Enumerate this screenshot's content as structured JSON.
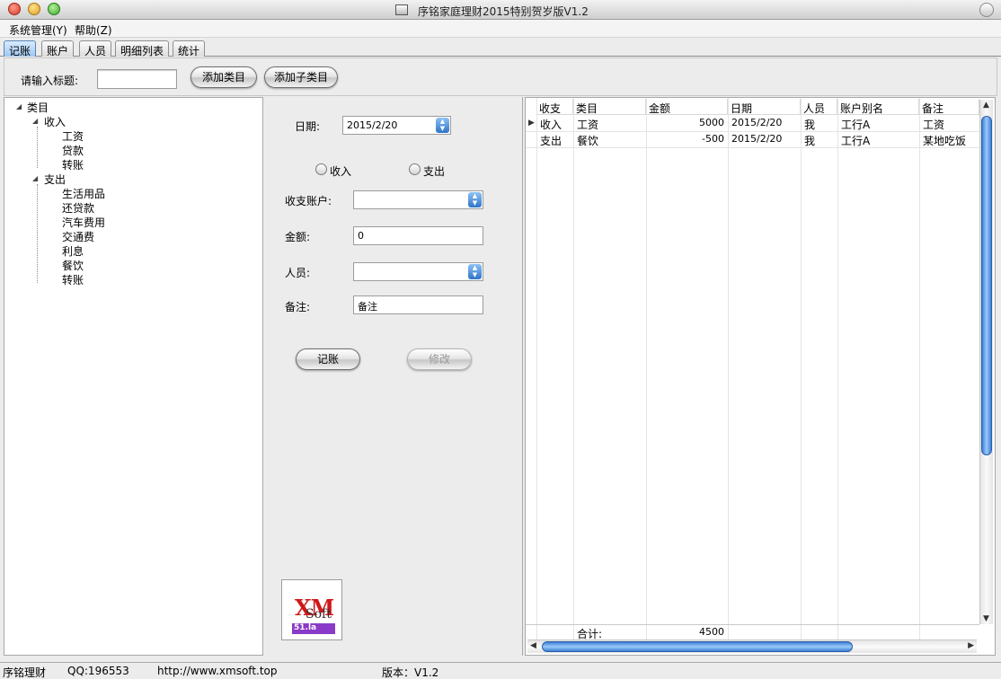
{
  "window": {
    "title": "序铭家庭理财2015特别贺岁版V1.2"
  },
  "menu": {
    "items": [
      "系统管理(Y)",
      "帮助(Z)"
    ]
  },
  "tabs": [
    "记账",
    "账户",
    "人员",
    "明细列表",
    "统计"
  ],
  "category_panel": {
    "prompt_label": "请输入标题:",
    "input_value": "",
    "add_category_label": "添加类目",
    "add_subcategory_label": "添加子类目"
  },
  "tree": {
    "root": "类目",
    "income": {
      "label": "收入",
      "children": [
        "工资",
        "贷款",
        "转账"
      ]
    },
    "expense": {
      "label": "支出",
      "children": [
        "生活用品",
        "还贷款",
        "汽车费用",
        "交通费",
        "利息",
        "餐饮",
        "转账"
      ]
    }
  },
  "entry_form": {
    "date_label": "日期:",
    "date_value": "2015/2/20",
    "radio_income": "收入",
    "radio_expense": "支出",
    "account_label": "收支账户:",
    "account_value": "",
    "amount_label": "金额:",
    "amount_value": "0",
    "person_label": "人员:",
    "person_value": "",
    "note_label": "备注:",
    "note_value": "备注",
    "record_button": "记账",
    "modify_button": "修改"
  },
  "logo": {
    "main": "XM",
    "sub": "Soft",
    "badge": "51.la"
  },
  "grid": {
    "columns": [
      "收支",
      "类目",
      "金额",
      "日期",
      "人员",
      "账户别名",
      "备注"
    ],
    "rows": [
      {
        "type": "收入",
        "category": "工资",
        "amount": "5000",
        "date": "2015/2/20",
        "person": "我",
        "account": "工行A",
        "note": "工资"
      },
      {
        "type": "支出",
        "category": "餐饮",
        "amount": "-500",
        "date": "2015/2/20",
        "person": "我",
        "account": "工行A",
        "note": "某地吃饭"
      }
    ],
    "footer": {
      "label": "合计:",
      "total": "4500"
    }
  },
  "status": {
    "app": "序铭理财",
    "qq": "QQ:196553",
    "url": "http://www.xmsoft.top",
    "version": "版本：V1.2"
  },
  "colors": {
    "tab_active": "#9fc7f0",
    "scroll_thumb": "#3a7fd8",
    "logo_red": "#d01818",
    "logo_purple": "#8a3ac8"
  }
}
